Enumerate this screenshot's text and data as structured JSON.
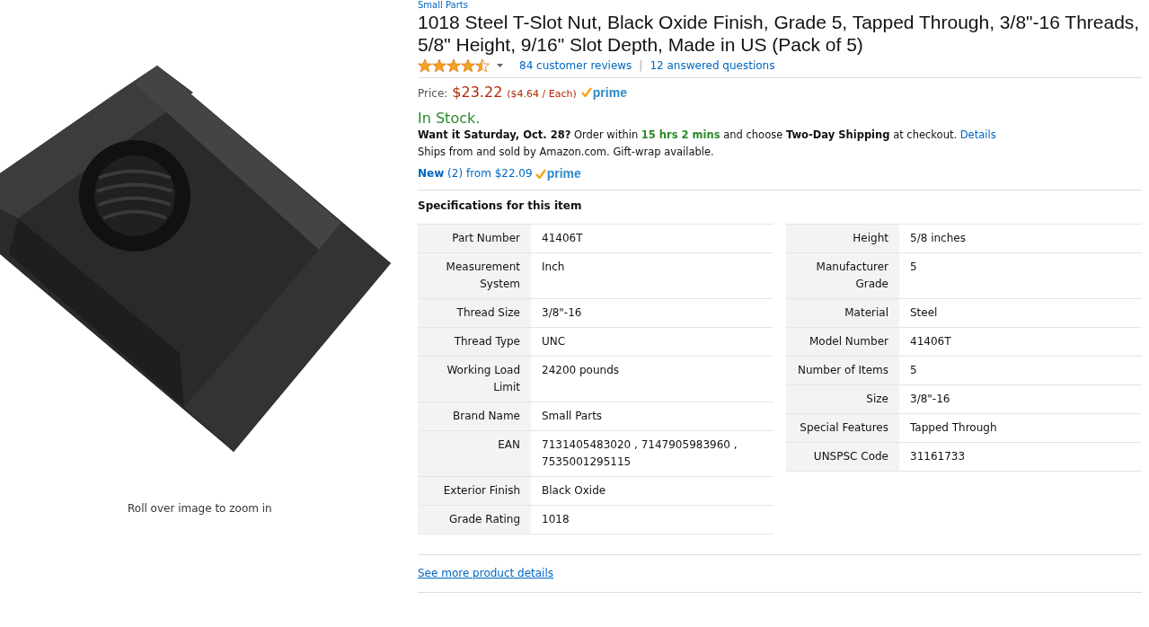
{
  "image": {
    "caption": "Roll over image to zoom in"
  },
  "brand": "Small Parts",
  "title": "1018 Steel T-Slot Nut, Black Oxide Finish, Grade 5, Tapped Through, 3/8\"-16 Threads, 5/8\" Height, 9/16\" Slot Depth, Made in US (Pack of 5)",
  "rating": {
    "stars": 4.5,
    "reviews": "84 customer reviews",
    "separator": "|",
    "questions": "12 answered questions"
  },
  "price": {
    "label": "Price:",
    "amount": "$23.22",
    "unit": "($4.64 / Each)",
    "prime": "prime"
  },
  "availability": "In Stock.",
  "delivery": [
    {
      "kind": "bold",
      "text": "Want it Saturday, Oct. 28?"
    },
    {
      "kind": "plain",
      "text": "Order within"
    },
    {
      "kind": "green",
      "text": "15 hrs 2 mins"
    },
    {
      "kind": "plain",
      "text": "and choose"
    },
    {
      "kind": "bold",
      "text": "Two-Day Shipping"
    },
    {
      "kind": "plain",
      "text": "at checkout."
    },
    {
      "kind": "link",
      "text": "Details"
    }
  ],
  "ships": "Ships from and sold by Amazon.com. Gift-wrap available.",
  "offers": {
    "text": "**New** (2) from $22.09",
    "prime": "prime"
  },
  "specs": {
    "title": "Specifications for this item",
    "columns": [
      [
        {
          "label": "Part Number",
          "value": "41406T"
        },
        {
          "label": "Measurement System",
          "value": "Inch"
        },
        {
          "label": "Thread Size",
          "value": "3/8\"-16"
        },
        {
          "label": "Thread Type",
          "value": "UNC"
        },
        {
          "label": "Working Load Limit",
          "value": "24200  pounds"
        },
        {
          "label": "Brand Name",
          "value": "Small Parts"
        },
        {
          "label": "EAN",
          "value": "7131405483020 , 7147905983960 , 7535001295115"
        },
        {
          "label": "Exterior Finish",
          "value": "Black Oxide"
        },
        {
          "label": "Grade Rating",
          "value": "1018"
        }
      ],
      [
        {
          "label": "Height",
          "value": "5/8  inches"
        },
        {
          "label": "Manufacturer Grade",
          "value": "5"
        },
        {
          "label": "Material",
          "value": "Steel"
        },
        {
          "label": "Model Number",
          "value": "41406T"
        },
        {
          "label": "Number of Items",
          "value": "5"
        },
        {
          "label": "Size",
          "value": "3/8\"-16"
        },
        {
          "label": "Special Features",
          "value": "Tapped Through"
        },
        {
          "label": "UNSPSC Code",
          "value": "31161733"
        }
      ]
    ]
  },
  "more_link": "See more product details"
}
